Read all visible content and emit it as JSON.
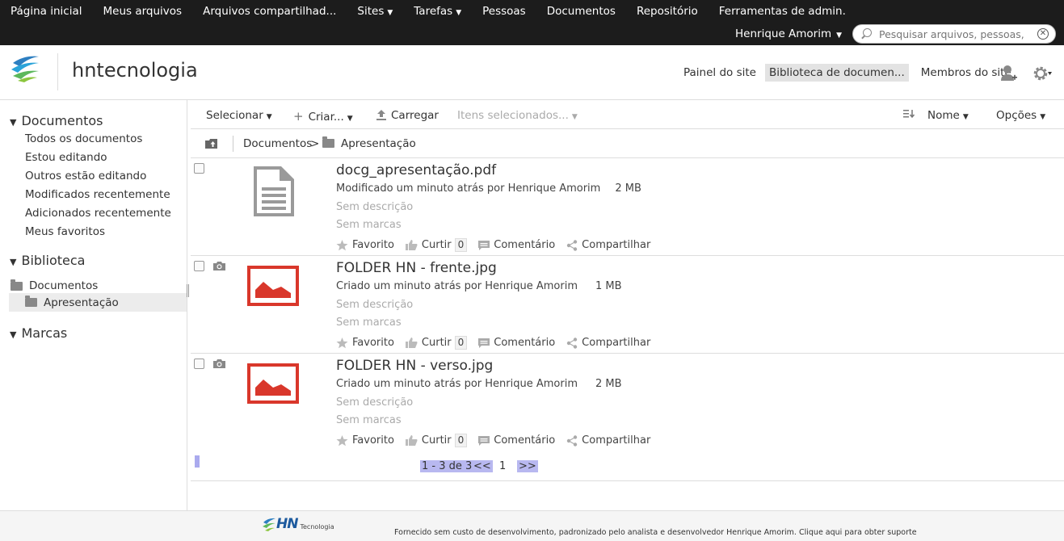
{
  "topnav": {
    "items": [
      {
        "label": "Página inicial",
        "caret": false
      },
      {
        "label": "Meus arquivos",
        "caret": false
      },
      {
        "label": "Arquivos compartilhad...",
        "caret": false
      },
      {
        "label": "Sites",
        "caret": true
      },
      {
        "label": "Tarefas",
        "caret": true
      },
      {
        "label": "Pessoas",
        "caret": false
      },
      {
        "label": "Documentos",
        "caret": false
      },
      {
        "label": "Repositório",
        "caret": false
      },
      {
        "label": "Ferramentas de admin.",
        "caret": false
      }
    ],
    "user": "Henrique Amorim",
    "search_placeholder": "Pesquisar arquivos, pessoas, sites"
  },
  "site": {
    "title": "hntecnologia",
    "nav": [
      "Painel do site",
      "Biblioteca de documen...",
      "Membros do site"
    ],
    "active_nav": 1
  },
  "sidebar": {
    "documents_heading": "Documentos",
    "filters": [
      "Todos os documentos",
      "Estou editando",
      "Outros estão editando",
      "Modificados recentemente",
      "Adicionados recentemente",
      "Meus favoritos"
    ],
    "library_heading": "Biblioteca",
    "tree": [
      "Documentos",
      "Apresentação"
    ],
    "tags_heading": "Marcas"
  },
  "toolbar": {
    "select": "Selecionar",
    "create": "Criar...",
    "upload": "Carregar",
    "selected_items": "Itens selecionados...",
    "sort": "Nome",
    "options": "Opções"
  },
  "breadcrumb": {
    "root": "Documentos",
    "separator": ">",
    "current": "Apresentação"
  },
  "documents": [
    {
      "name": "docg_apresentação.pdf",
      "meta": "Modificado um minuto atrás por Henrique Amorim",
      "size": "2 MB",
      "description": "Sem descrição",
      "tags": "Sem marcas",
      "type": "pdf"
    },
    {
      "name": "FOLDER HN - frente.jpg",
      "meta": "Criado um minuto atrás por Henrique Amorim",
      "size": "1 MB",
      "description": "Sem descrição",
      "tags": "Sem marcas",
      "type": "image"
    },
    {
      "name": "FOLDER HN - verso.jpg",
      "meta": "Criado um minuto atrás por Henrique Amorim",
      "size": "2 MB",
      "description": "Sem descrição",
      "tags": "Sem marcas",
      "type": "image"
    }
  ],
  "actions": {
    "favorite": "Favorito",
    "like": "Curtir",
    "like_count": "0",
    "comment": "Comentário",
    "share": "Compartilhar"
  },
  "pagination": {
    "range": "1 - 3 de 3",
    "prev": "<<",
    "page": "1",
    "next": ">>"
  },
  "footer": {
    "logo_text": "HN",
    "logo_sub": "Tecnologia",
    "text": "Fornecido sem custo de desenvolvimento, padronizado pelo analista e desenvolvedor Henrique Amorim.",
    "support_link": "Clique aqui para obter suporte"
  },
  "colors": {
    "topbar": "#1c1c1c",
    "image_icon": "#d9372b",
    "pdf_icon": "#999999",
    "pager_highlight": "#b8b8f0"
  }
}
